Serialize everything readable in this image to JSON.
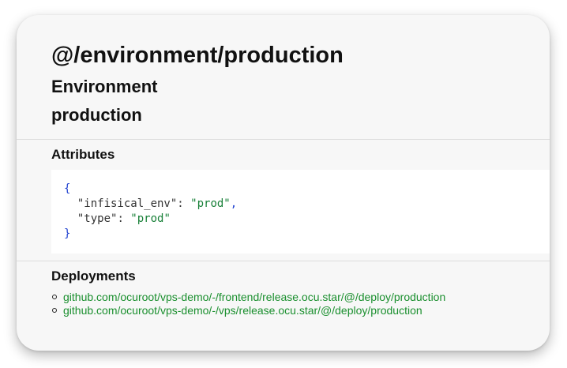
{
  "page": {
    "title": "@/environment/production",
    "kind": "Environment",
    "name": "production"
  },
  "attributes": {
    "heading": "Attributes",
    "open_brace": "{",
    "close_brace": "}",
    "entries": [
      {
        "key": "\"infisical_env\"",
        "value": "\"prod\"",
        "sep": ": ",
        "trail": ","
      },
      {
        "key": "\"type\"",
        "value": "\"prod\"",
        "sep": ": ",
        "trail": ""
      }
    ]
  },
  "deployments": {
    "heading": "Deployments",
    "items": [
      "github.com/ocuroot/vps-demo/-/frontend/release.ocu.star/@/deploy/production",
      "github.com/ocuroot/vps-demo/-/vps/release.ocu.star/@/deploy/production"
    ]
  },
  "colors": {
    "card_background": "#f7f7f7",
    "link": "#1a8f2e",
    "json_string": "#188038",
    "json_punctuation": "#1d3fcf"
  }
}
